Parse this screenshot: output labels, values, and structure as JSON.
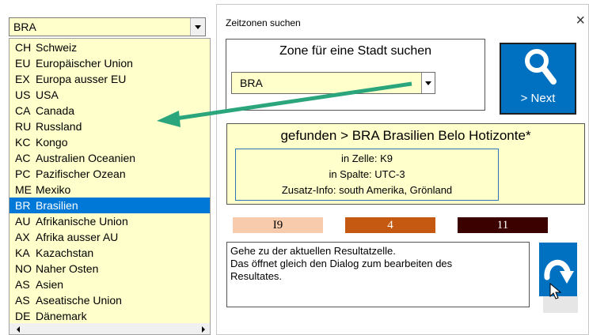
{
  "combo": {
    "value": "BRA"
  },
  "list": {
    "items": [
      {
        "code": "CH",
        "name": "Schweiz",
        "selected": false
      },
      {
        "code": "EU",
        "name": "Europäischer Union",
        "selected": false
      },
      {
        "code": "EX",
        "name": "Europa ausser EU",
        "selected": false
      },
      {
        "code": "US",
        "name": "USA",
        "selected": false
      },
      {
        "code": "CA",
        "name": "Canada",
        "selected": false
      },
      {
        "code": "RU",
        "name": "Russland",
        "selected": false
      },
      {
        "code": "KC",
        "name": "Kongo",
        "selected": false
      },
      {
        "code": "AC",
        "name": "Australien Oceanien",
        "selected": false
      },
      {
        "code": "PC",
        "name": "Pazifischer Ozean",
        "selected": false
      },
      {
        "code": "ME",
        "name": "Mexiko",
        "selected": false
      },
      {
        "code": "BR",
        "name": "Brasilien",
        "selected": true
      },
      {
        "code": "AU",
        "name": "Afrikanische Union",
        "selected": false
      },
      {
        "code": "AX",
        "name": "Afrika ausser AU",
        "selected": false
      },
      {
        "code": "KA",
        "name": "Kazachstan",
        "selected": false
      },
      {
        "code": "NO",
        "name": "Naher Osten",
        "selected": false
      },
      {
        "code": "AS",
        "name": "Asien",
        "selected": false
      },
      {
        "code": "AS",
        "name": "Aseatische Union",
        "selected": false
      },
      {
        "code": "DE",
        "name": "Dänemark",
        "selected": false
      }
    ]
  },
  "dialog": {
    "title": "Zeitzonen suchen",
    "close": "×",
    "search_label": "Zone für eine Stadt suchen",
    "zone_value": "BRA",
    "next_label": "> Next",
    "result": {
      "title": "gefunden > BRA Brasilien Belo Hotizonte*",
      "cell": "in Zelle: K9",
      "column": "in Spalte: UTC-3",
      "extra": "Zusatz-Info: south Amerika, Grönland"
    },
    "chips": [
      "I9",
      "4",
      "11"
    ],
    "help": [
      "Gehe zu der aktuellen Resultatzelle.",
      "Das öffnet gleich den Dialog zum bearbeiten des",
      "Resultates."
    ]
  },
  "colors": {
    "list_bg": "#ffffcc",
    "selection": "#0078d7",
    "button_blue": "#0070c0",
    "pointer_arrow": "#2aa57c",
    "chip_light": "#f8cbad",
    "chip_mid": "#c65911",
    "chip_dark": "#3b0000"
  },
  "icons": {
    "search": "magnifier-icon",
    "goto": "curved-arrow-down-icon",
    "pointer": "green-arrow-icon",
    "cursor": "mouse-cursor-icon"
  }
}
